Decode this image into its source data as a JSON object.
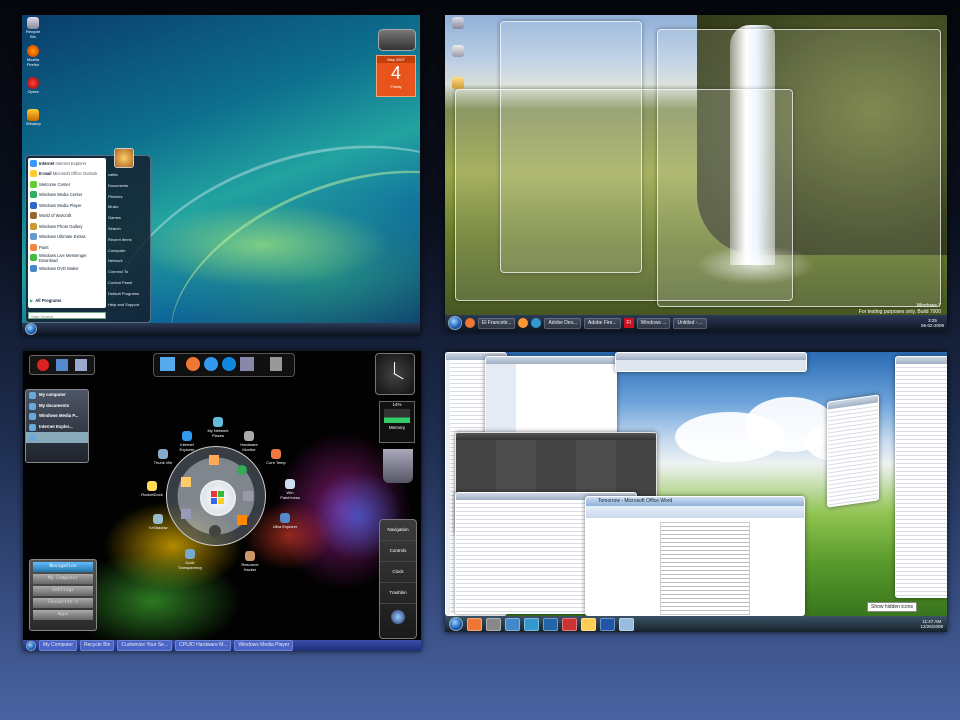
{
  "panel1": {
    "desktop_icons": [
      "Recycle Bin",
      "Mozilla Firefox",
      "Opera",
      "Winamp"
    ],
    "calendar": {
      "month": "May 2007",
      "day": "4",
      "weekday": "Friday"
    },
    "start_menu": {
      "pinned": [
        {
          "title": "Internet",
          "sub": "Internet Explorer"
        },
        {
          "title": "E-mail",
          "sub": "Microsoft Office Outlook"
        }
      ],
      "programs": [
        "Welcome Center",
        "Windows Media Center",
        "Windows Media Player",
        "World of Warcraft",
        "Windows Photo Gallery",
        "Windows Ultimate Extras",
        "Paint",
        "Windows Live Messenger Download",
        "Windows DVD Maker"
      ],
      "all_programs": "All Programs",
      "search_placeholder": "Start Search",
      "right": [
        "cattia",
        "Documents",
        "Pictures",
        "Music",
        "Games",
        "Search",
        "Recent Items",
        "Computer",
        "Network",
        "Connect To",
        "Control Panel",
        "Default Programs",
        "Help and Support"
      ]
    }
  },
  "panel2": {
    "watermark": {
      "line1": "Windows 7",
      "line2": "For testing purposes only. Build 7000"
    },
    "taskbar": [
      "El Francotir...",
      "Adobe Dev...",
      "Adobe Fire...",
      "Windows ...",
      "Untitled - ..."
    ],
    "clock": {
      "time": "3:25",
      "date": "06-02-2009"
    }
  },
  "panel3": {
    "menu": [
      "My computer",
      "My documents",
      "Windows Media P...",
      "Internet Explor..."
    ],
    "circle_icons": [
      "My Network Places",
      "Internet Explorer",
      "Hardware Monitor",
      "Thunk Vile",
      "Core Temp",
      "RocketDock",
      "Win Patch'ness",
      "YzShadow",
      "Ultra Explorer",
      "Dock Transparency",
      "Resource Hacker"
    ],
    "nav_box": [
      "Navigation",
      "My Computer",
      "Settings",
      "Favourite's",
      "Apps"
    ],
    "right_nav": [
      "Navigation",
      "Controls",
      "Clock",
      "Trashbin"
    ],
    "meters": {
      "cpu": "14%",
      "label": "Memory"
    },
    "taskbar": [
      "My Computer",
      "Recycle Bin",
      "Customize Your Se...",
      "CPUID Hardware M...",
      "Windows Media Player"
    ]
  },
  "panel4": {
    "word_title": "Tomorrow - Microsoft Office Word",
    "tooltip": "Show hidden icons",
    "clock": {
      "time": "11:47 AM",
      "date": "12/26/2008"
    }
  }
}
